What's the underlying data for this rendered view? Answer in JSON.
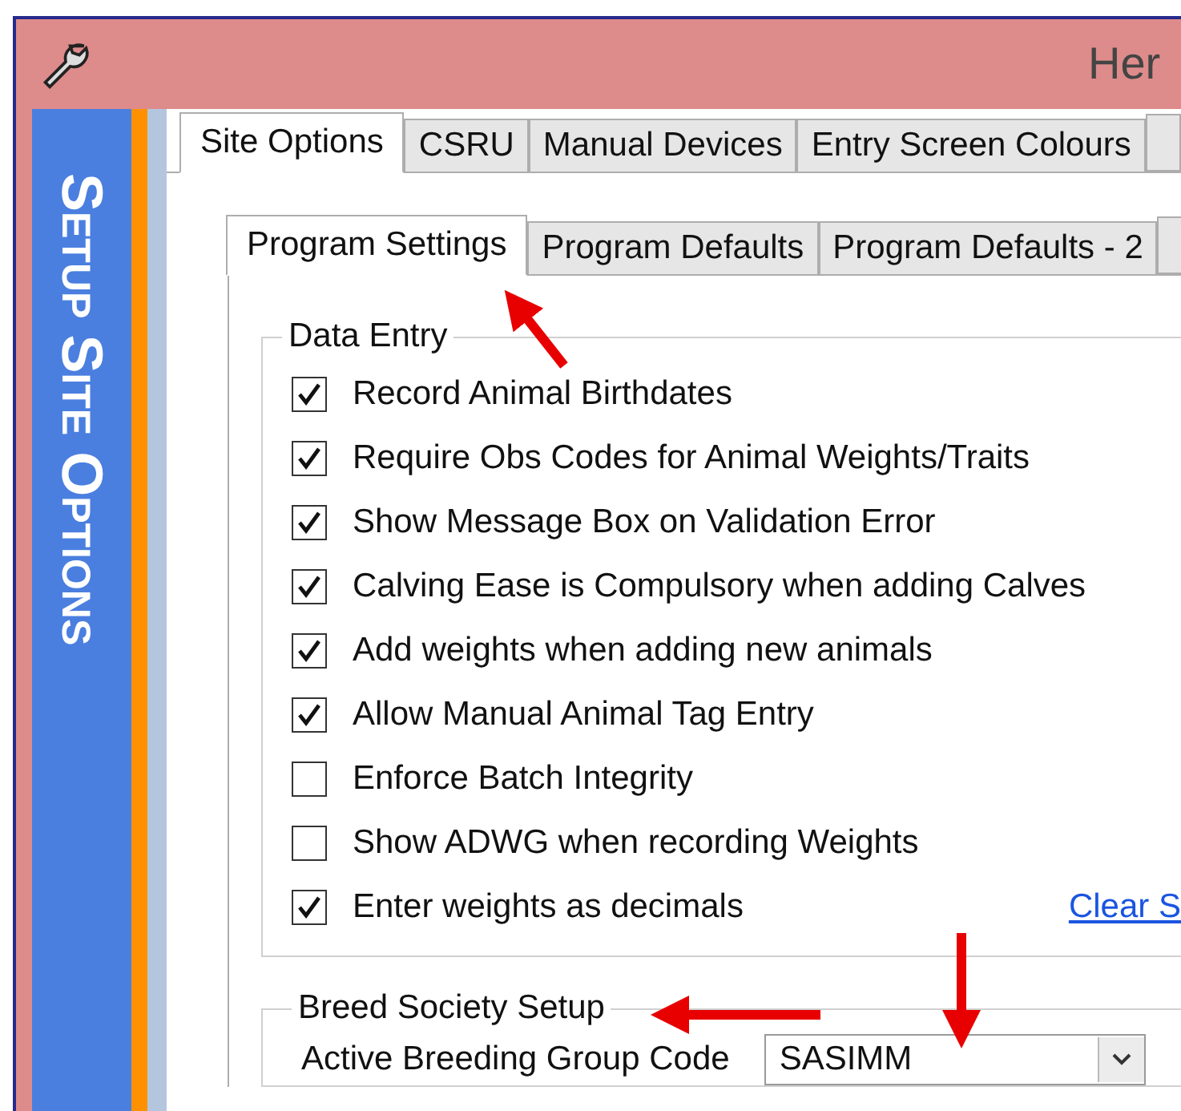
{
  "window": {
    "title": "Her"
  },
  "sidebar": {
    "title": "Setup Site Options"
  },
  "tabs": [
    {
      "label": "Site Options",
      "selected": true
    },
    {
      "label": "CSRU",
      "selected": false
    },
    {
      "label": "Manual Devices",
      "selected": false
    },
    {
      "label": "Entry Screen Colours",
      "selected": false
    }
  ],
  "sub_tabs": [
    {
      "label": "Program Settings",
      "selected": true
    },
    {
      "label": "Program Defaults",
      "selected": false
    },
    {
      "label": "Program Defaults - 2",
      "selected": false
    }
  ],
  "data_entry": {
    "title": "Data Entry",
    "link": "Clear S",
    "options": [
      {
        "label": "Record Animal Birthdates",
        "checked": true
      },
      {
        "label": "Require Obs Codes for Animal Weights/Traits",
        "checked": true
      },
      {
        "label": "Show Message Box on Validation Error",
        "checked": true
      },
      {
        "label": "Calving Ease is Compulsory when adding Calves",
        "checked": true
      },
      {
        "label": "Add weights when adding new animals",
        "checked": true
      },
      {
        "label": "Allow Manual Animal Tag Entry",
        "checked": true
      },
      {
        "label": "Enforce Batch Integrity",
        "checked": false
      },
      {
        "label": "Show ADWG when recording Weights",
        "checked": false
      },
      {
        "label": "Enter weights as decimals",
        "checked": true
      }
    ]
  },
  "breed_society": {
    "title": "Breed Society Setup",
    "field_label": "Active Breeding Group Code",
    "field_value": "SASIMM"
  }
}
